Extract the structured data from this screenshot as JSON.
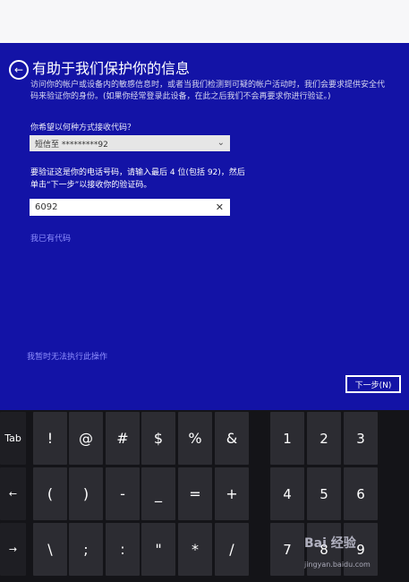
{
  "page": {
    "title": "有助于我们保护你的信息",
    "description": "访问你的帐户或设备内的敏感信息时，或者当我们检测到可疑的帐户活动时，我们会要求提供安全代码来验证你的身份。(如果你经常登录此设备，在此之后我们不会再要求你进行验证。)",
    "question_receive": "你希望以何种方式接收代码？",
    "method_value": "短信至 *********92",
    "verify_prompt": "要验证这是你的电话号码，请输入最后 4 位(包括 92)，然后单击“下一步”以接收你的验证码。",
    "phone_digits_value": "6092",
    "have_code_link": "我已有代码",
    "cannot_do_link": "我暂时无法执行此操作",
    "next_button": "下一步(N)"
  },
  "keyboard": {
    "rows": [
      [
        "Tab",
        "!",
        "@",
        "#",
        "$",
        "%",
        "&",
        "1",
        "2",
        "3"
      ],
      [
        "←",
        "(",
        ")",
        "-",
        "_",
        "=",
        "+",
        "4",
        "5",
        "6"
      ],
      [
        "→",
        "\\",
        ";",
        ":",
        "\"",
        "*",
        "/",
        "7",
        "8",
        "9"
      ]
    ]
  },
  "watermark": {
    "brand": "Bai 经验",
    "url": "jingyan.baidu.com"
  },
  "colors": {
    "screen_bg": "#1313a6",
    "link": "#8f8fff",
    "key_bg": "#2c2c32",
    "keyboard_bg": "#141418"
  }
}
